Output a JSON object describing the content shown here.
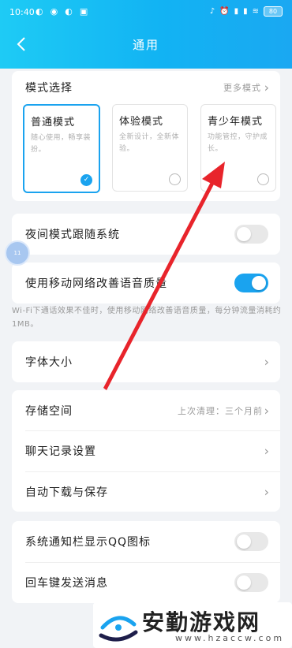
{
  "status_bar": {
    "time": "10:40",
    "left_icons": [
      "wechat-icon",
      "bot-icon",
      "wechat-icon",
      "image-icon"
    ],
    "right_icons": [
      "mute-icon",
      "alarm-icon",
      "signal-icon",
      "signal-icon",
      "wifi-icon"
    ],
    "battery": "80"
  },
  "header": {
    "title": "通用"
  },
  "mode_section": {
    "title": "模式选择",
    "more": "更多模式",
    "modes": [
      {
        "name": "普通模式",
        "desc": "随心使用，畅享装扮。",
        "selected": true
      },
      {
        "name": "体验模式",
        "desc": "全新设计，全新体验。",
        "selected": false
      },
      {
        "name": "青少年模式",
        "desc": "功能管控，守护成长。",
        "selected": false
      }
    ]
  },
  "night_mode": {
    "label": "夜间模式跟随系统",
    "enabled": false
  },
  "mobile_voice": {
    "label": "使用移动网络改善语音质量",
    "enabled": true
  },
  "mobile_voice_note": "Wi-Fi下通话效果不佳时，使用移动网络改善语音质量，每分钟流量消耗约1MB。",
  "font_size": {
    "label": "字体大小"
  },
  "storage_group": {
    "storage": {
      "label": "存储空间",
      "sub": "上次清理：三个月前"
    },
    "chat_history": {
      "label": "聊天记录设置"
    },
    "auto_download": {
      "label": "自动下载与保存"
    }
  },
  "notify_group": {
    "qq_icon": {
      "label": "系统通知栏显示QQ图标",
      "enabled": false
    },
    "enter_send": {
      "label": "回车键发送消息",
      "enabled": false
    }
  },
  "floating_button": "11",
  "watermark": {
    "title": "安勤游戏网",
    "url": "www.hzaccw.com"
  },
  "colors": {
    "accent": "#1aa3ef",
    "header": "#12b3f3",
    "arrow": "#e8242b"
  }
}
